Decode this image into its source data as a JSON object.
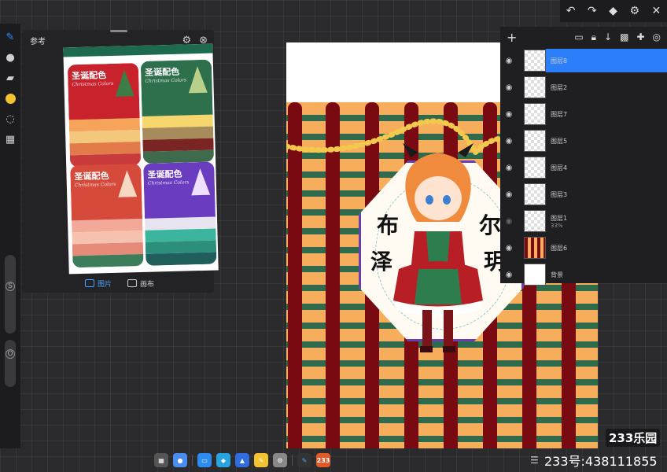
{
  "reference_panel": {
    "title": "参考",
    "settings_icon": "gear-icon",
    "close_icon": "close-circle-icon",
    "tabs": [
      {
        "label": "图片",
        "icon": "image-icon",
        "active": true
      },
      {
        "label": "画布",
        "icon": "canvas-icon",
        "active": false
      }
    ],
    "cards": [
      {
        "title": "圣诞配色",
        "subtitle": "Christmas Colors",
        "color": "#c8232c",
        "tree": "#3c7d45"
      },
      {
        "title": "圣诞配色",
        "subtitle": "Christmas Colors",
        "color": "#2e6f4c",
        "tree": "#b8d089"
      },
      {
        "title": "圣诞配色",
        "subtitle": "Christmas Colors",
        "color": "#d64a3b",
        "tree": "#f6d9c2"
      },
      {
        "title": "圣诞配色",
        "subtitle": "Christmas Colors",
        "color": "#6a3dc0",
        "tree": "#f0e0ff"
      }
    ]
  },
  "canvas": {
    "characters": [
      "布",
      "尔",
      "泽",
      "玥"
    ]
  },
  "layers": {
    "toolbar_icons": [
      "plus-icon",
      "folder-icon",
      "lock-icon",
      "merge-down-icon",
      "checker-icon",
      "pin-icon",
      "target-icon"
    ],
    "items": [
      {
        "name": "图层8",
        "selected": true,
        "opacity": ""
      },
      {
        "name": "图层2",
        "selected": false,
        "opacity": ""
      },
      {
        "name": "图层7",
        "selected": false,
        "opacity": ""
      },
      {
        "name": "图层5",
        "selected": false,
        "opacity": ""
      },
      {
        "name": "图层4",
        "selected": false,
        "opacity": ""
      },
      {
        "name": "图层3",
        "selected": false,
        "opacity": ""
      },
      {
        "name": "图层1",
        "selected": false,
        "opacity": "33%"
      },
      {
        "name": "图层6",
        "selected": false,
        "opacity": ""
      },
      {
        "name": "背景",
        "selected": false,
        "opacity": ""
      }
    ]
  },
  "top_bar": {
    "undo": "↶",
    "redo": "↷",
    "layers": "◆",
    "settings": "⚙",
    "close": "✕"
  },
  "watermark": {
    "logo": "233乐园",
    "account": "233号:438111855"
  },
  "colors": {
    "accent": "#2d7ff9",
    "current_brush_color": "#f2c230"
  }
}
